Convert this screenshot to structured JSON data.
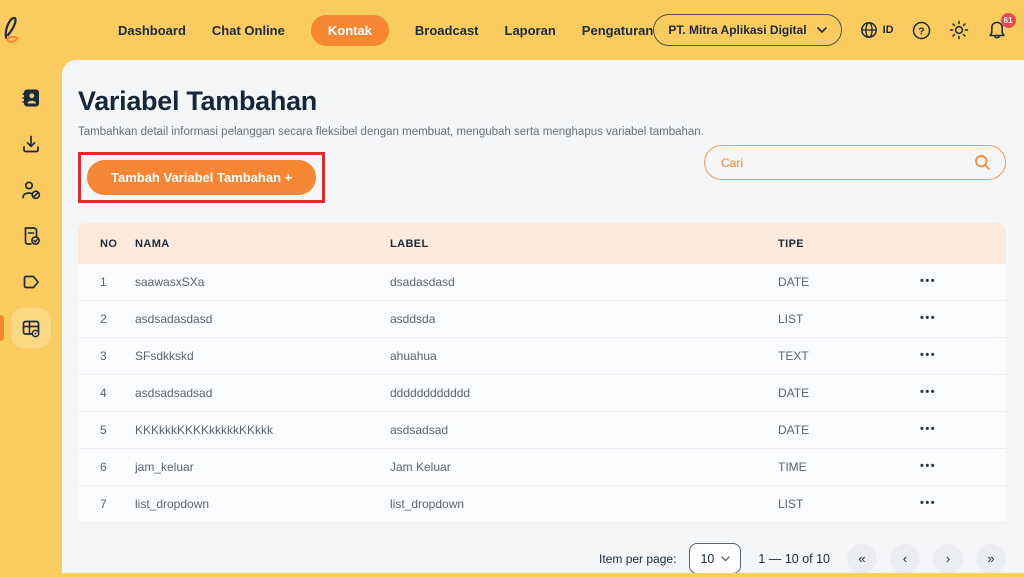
{
  "topbar": {
    "nav": [
      {
        "label": "Dashboard"
      },
      {
        "label": "Chat Online"
      },
      {
        "label": "Kontak"
      },
      {
        "label": "Broadcast"
      },
      {
        "label": "Laporan"
      },
      {
        "label": "Pengaturan"
      }
    ],
    "active_nav": "Kontak",
    "company_selector": {
      "value": "PT. Mitra Aplikasi Digital"
    },
    "language_label": "ID",
    "notification_badge": "61"
  },
  "sidebar": {
    "items": [
      {
        "icon": "contact-book-icon"
      },
      {
        "icon": "import-icon"
      },
      {
        "icon": "blocked-contact-icon"
      },
      {
        "icon": "document-check-icon"
      },
      {
        "icon": "tag-icon"
      },
      {
        "icon": "custom-fields-icon",
        "active": true
      }
    ]
  },
  "page": {
    "title": "Variabel Tambahan",
    "description": "Tambahkan detail informasi pelanggan secara fleksibel dengan membuat, mengubah serta menghapus variabel tambahan.",
    "add_button_label": "Tambah Variabel Tambahan +",
    "search_placeholder": "Cari"
  },
  "table": {
    "columns": [
      "NO",
      "NAMA",
      "LABEL",
      "TIPE"
    ],
    "actions_icon": "•••",
    "rows": [
      {
        "no": "1",
        "nama": "saawasxSXa",
        "label": "dsadasdasd",
        "tipe": "DATE"
      },
      {
        "no": "2",
        "nama": "asdsadasdasd",
        "label": "asddsda",
        "tipe": "LIST"
      },
      {
        "no": "3",
        "nama": "SFsdkkskd",
        "label": "ahuahua",
        "tipe": "TEXT"
      },
      {
        "no": "4",
        "nama": "asdsadsadsad",
        "label": "dddddddddddd",
        "tipe": "DATE"
      },
      {
        "no": "5",
        "nama": "KKKkkkKKKKkkkkkKKkkk",
        "label": "asdsadsad",
        "tipe": "DATE"
      },
      {
        "no": "6",
        "nama": "jam_keluar",
        "label": "Jam Keluar",
        "tipe": "TIME"
      },
      {
        "no": "7",
        "nama": "list_dropdown",
        "label": "list_dropdown",
        "tipe": "LIST"
      }
    ]
  },
  "pagination": {
    "items_per_page_label": "Item per page:",
    "items_per_page_value": "10",
    "range_text": "1 — 10 of 10",
    "first_icon": "«",
    "prev_icon": "‹",
    "next_icon": "›",
    "last_icon": "»"
  },
  "colors": {
    "brand_yellow": "#FACB5F",
    "accent_orange": "#F58634",
    "text_dark": "#1B2A3D",
    "header_peach": "#FCEBDC",
    "annotation_red": "#DE2A2A",
    "badge_red": "#E5484D",
    "online_green": "#2FBF71"
  }
}
